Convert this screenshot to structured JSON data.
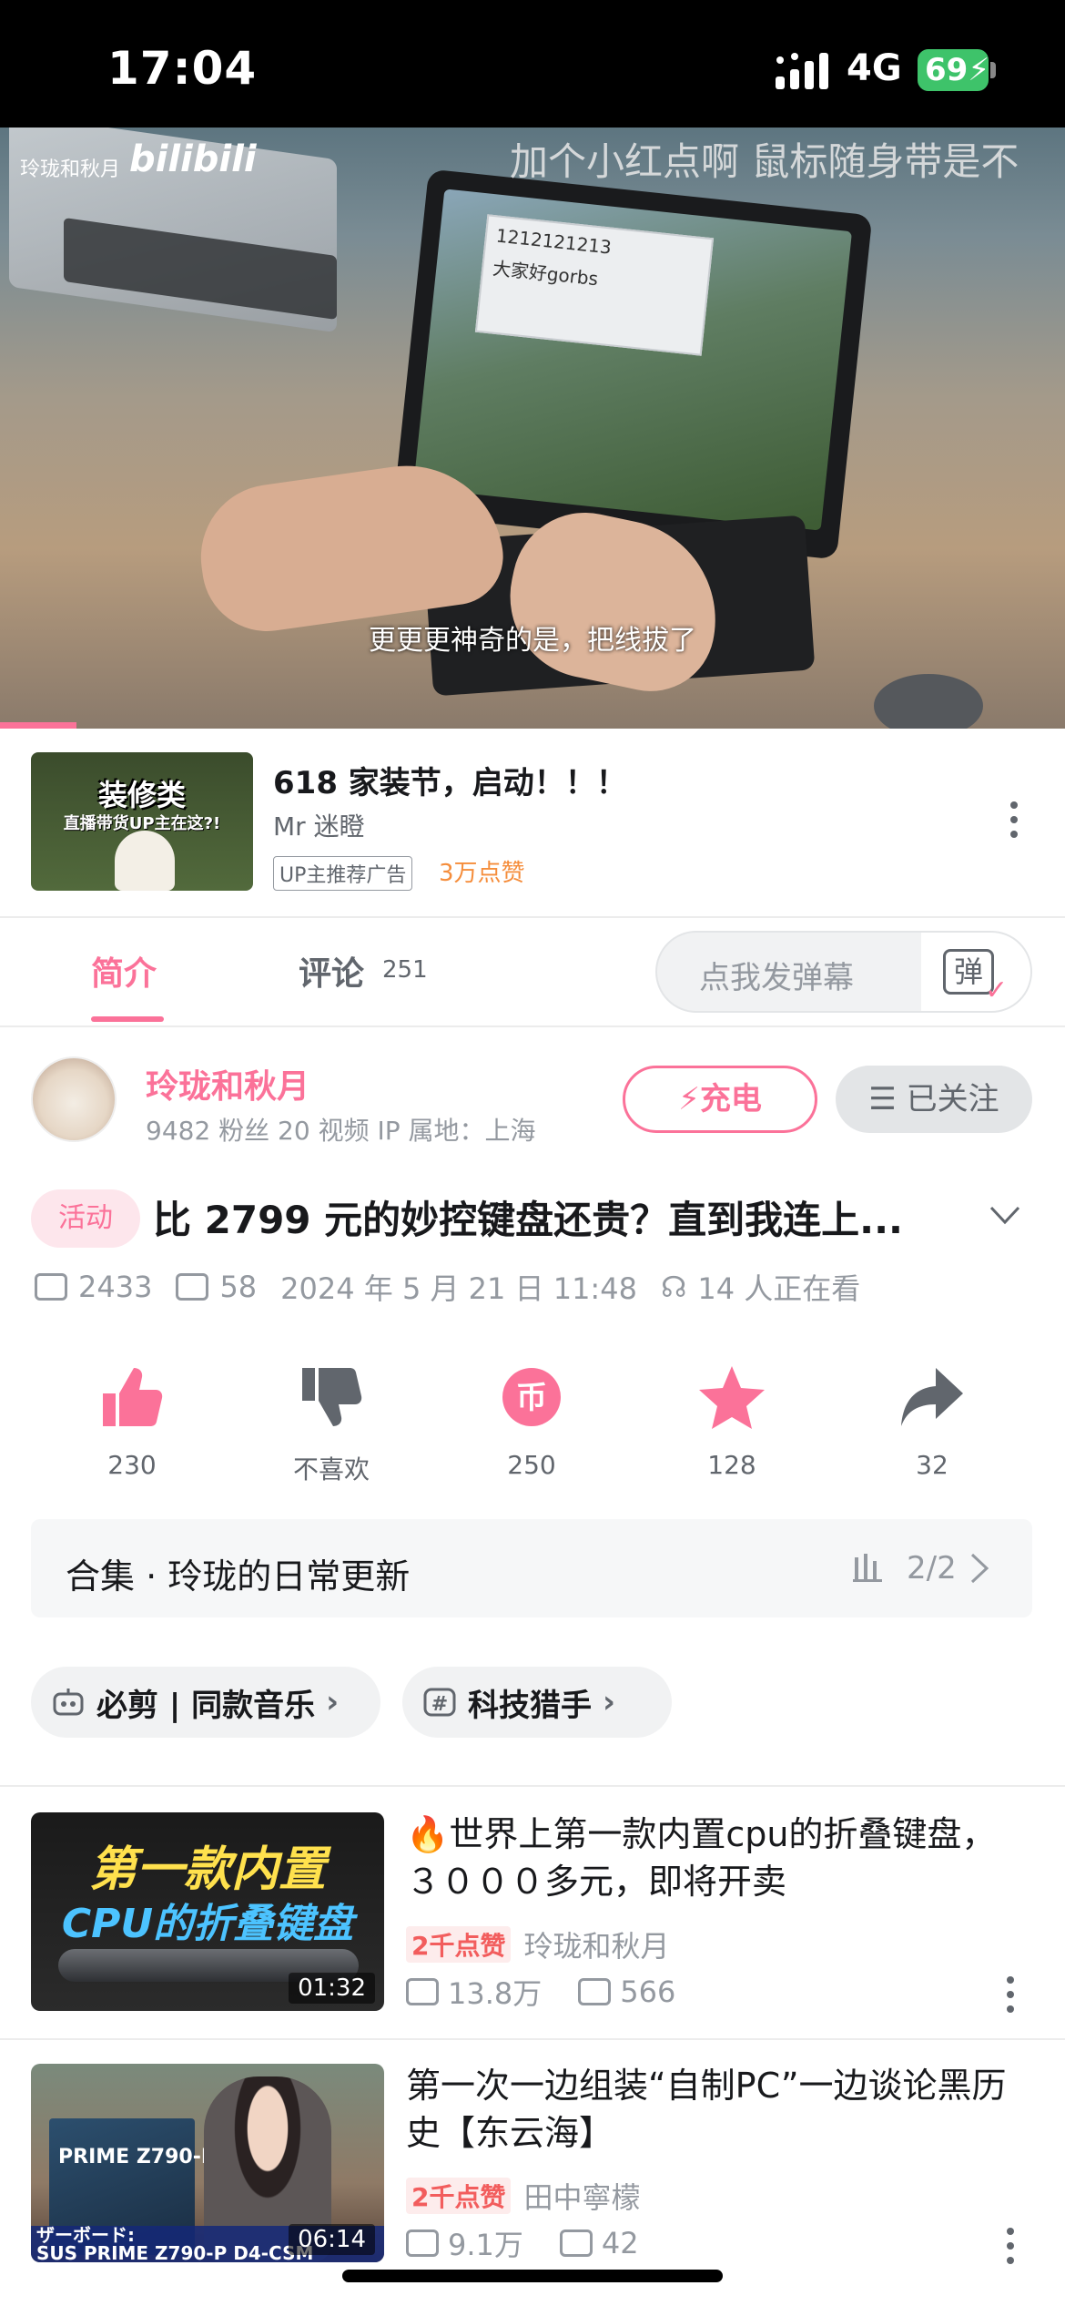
{
  "status_bar": {
    "time": "17:04",
    "network": "4G",
    "battery": "69",
    "icons": [
      "signal-icon",
      "battery-charging-icon"
    ]
  },
  "video": {
    "watermark_text": "玲珑和秋月",
    "watermark_logo": "bilibili",
    "danmaku": "加个小红点啊 鼠标随身带是不",
    "screen_text": [
      "1212121213",
      "大家好gorbs"
    ],
    "subtitle": "更更更神奇的是，把线拔了"
  },
  "ad": {
    "thumb_title": "装修类",
    "thumb_subtitle": "直播带货UP主在这?!",
    "title": "618 家装节，启动！！！",
    "author": "Mr 迷瞪",
    "badge": "UP主推荐广告",
    "likes": "3万点赞"
  },
  "tabs": {
    "intro": "简介",
    "comments": "评论",
    "comments_count": "251",
    "danmaku_placeholder": "点我发弹幕",
    "danmaku_glyph": "弹"
  },
  "uploader": {
    "name": "玲珑和秋月",
    "stats": "9482 粉丝   20 视频   IP 属地：上海",
    "charge_label": "充电",
    "follow_label": "已关注"
  },
  "video_info": {
    "activity_tag": "活动",
    "title": "比 2799 元的妙控键盘还贵？直到我连上...",
    "plays": "2433",
    "danmaku_count": "58",
    "date": "2024 年 5 月 21 日 11:48",
    "watching": "14 人正在看"
  },
  "actions": {
    "like": "230",
    "dislike": "不喜欢",
    "coin": "250",
    "favorite": "128",
    "share": "32",
    "coin_glyph": "币"
  },
  "collection": {
    "label": "合集 · 玲珑的日常更新",
    "progress": "2/2"
  },
  "chips": {
    "music": "必剪 | 同款音乐",
    "tech": "科技猎手"
  },
  "recommendations": [
    {
      "thumb_line1": "第一款内置",
      "thumb_line2": "CPU的折叠键盘",
      "duration": "01:32",
      "title": "🔥世界上第一款内置cpu的折叠键盘，３０００多元，即将开卖",
      "hot": "2千点赞",
      "author": "玲珑和秋月",
      "plays": "13.8万",
      "comments": "566"
    },
    {
      "thumb_text": "PRIME Z790-P D4",
      "thumb_strip_1": "ザーボード:",
      "thumb_strip_2": "SUS PRIME Z790-P D4-CSM",
      "duration": "06:14",
      "title": "第一次一边组装“自制PC”一边谈论黑历史【东云海】",
      "hot": "2千点赞",
      "author": "田中寧檬",
      "plays": "9.1万",
      "comments": "42"
    }
  ],
  "colors": {
    "accent": "#fb7299",
    "gray_text": "#9499a0",
    "orange": "#f58d3b",
    "hot_red": "#f25d5d"
  }
}
